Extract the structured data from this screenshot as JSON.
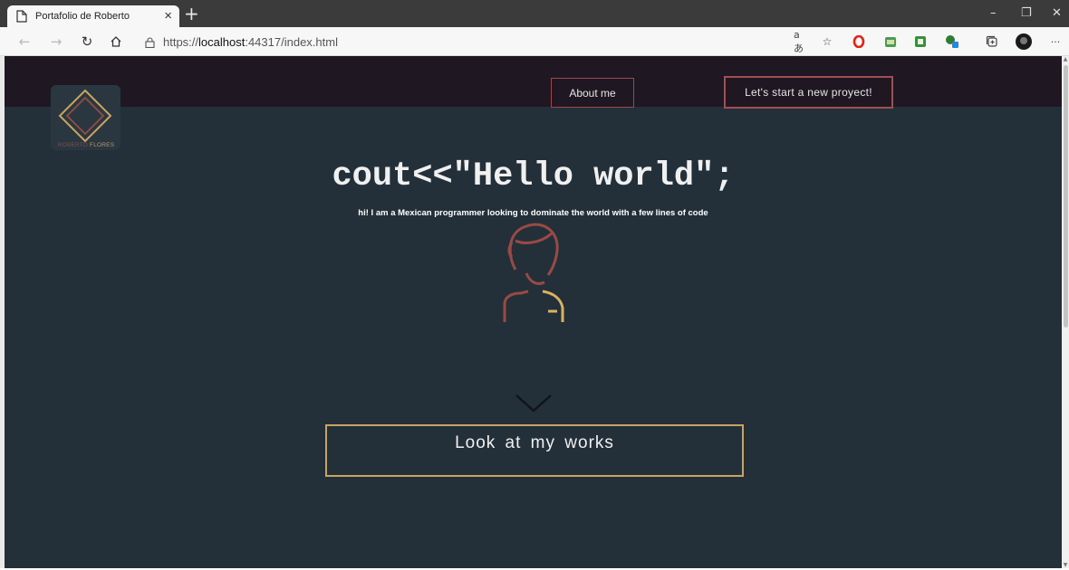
{
  "browser": {
    "tab_title": "Portafolio de Roberto",
    "tab_close": "×",
    "new_tab": "+",
    "url_prefix": "https://",
    "url_host": "localhost",
    "url_rest": ":44317/index.html",
    "window_minimize": "–",
    "window_restore": "❐",
    "window_close": "✕",
    "more": "···",
    "extensions": [
      "read-aloud-icon",
      "favorites-icon",
      "opera-icon",
      "image-extension-icon",
      "green-extension-icon",
      "notification-extension-icon",
      "collections-icon",
      "profile-avatar-icon"
    ]
  },
  "site": {
    "logo_first": "ROBERTO",
    "logo_last": "FLORES",
    "nav": {
      "about": "About me",
      "project": "Let's start a new proyect!"
    },
    "hero": {
      "title": "cout<<\"Hello world\";",
      "subtitle": "hi! I am a Mexican programmer looking to dominate the world with a few lines of code"
    },
    "cta": "Look at my works"
  },
  "colors": {
    "header_bg": "#1f1823",
    "page_bg": "#23303a",
    "accent_red": "#9b4a4b",
    "accent_gold": "#c9a461"
  }
}
